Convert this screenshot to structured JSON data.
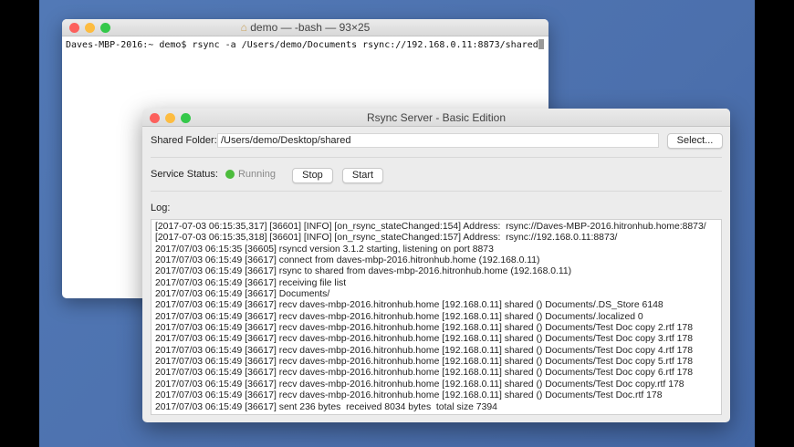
{
  "terminal": {
    "title": "demo — -bash — 93×25",
    "prompt": "Daves-MBP-2016:~ demo$ ",
    "command": "rsync -a /Users/demo/Documents rsync://192.168.0.11:8873/shared"
  },
  "app": {
    "title": "Rsync Server - Basic Edition",
    "shared_folder_label": "Shared Folder:",
    "shared_folder_value": "/Users/demo/Desktop/shared",
    "select_label": "Select...",
    "status_label": "Service Status:",
    "status_value": "Running",
    "status_color": "#4cbc3c",
    "stop_label": "Stop",
    "start_label": "Start",
    "log_label": "Log:",
    "log_lines": [
      "[2017-07-03 06:15:35,317] [36601] [INFO] [on_rsync_stateChanged:154] Address:  rsync://Daves-MBP-2016.hitronhub.home:8873/",
      "[2017-07-03 06:15:35,318] [36601] [INFO] [on_rsync_stateChanged:157] Address:  rsync://192.168.0.11:8873/",
      "2017/07/03 06:15:35 [36605] rsyncd version 3.1.2 starting, listening on port 8873",
      "2017/07/03 06:15:49 [36617] connect from daves-mbp-2016.hitronhub.home (192.168.0.11)",
      "2017/07/03 06:15:49 [36617] rsync to shared from daves-mbp-2016.hitronhub.home (192.168.0.11)",
      "2017/07/03 06:15:49 [36617] receiving file list",
      "2017/07/03 06:15:49 [36617] Documents/",
      "2017/07/03 06:15:49 [36617] recv daves-mbp-2016.hitronhub.home [192.168.0.11] shared () Documents/.DS_Store 6148",
      "2017/07/03 06:15:49 [36617] recv daves-mbp-2016.hitronhub.home [192.168.0.11] shared () Documents/.localized 0",
      "2017/07/03 06:15:49 [36617] recv daves-mbp-2016.hitronhub.home [192.168.0.11] shared () Documents/Test Doc copy 2.rtf 178",
      "2017/07/03 06:15:49 [36617] recv daves-mbp-2016.hitronhub.home [192.168.0.11] shared () Documents/Test Doc copy 3.rtf 178",
      "2017/07/03 06:15:49 [36617] recv daves-mbp-2016.hitronhub.home [192.168.0.11] shared () Documents/Test Doc copy 4.rtf 178",
      "2017/07/03 06:15:49 [36617] recv daves-mbp-2016.hitronhub.home [192.168.0.11] shared () Documents/Test Doc copy 5.rtf 178",
      "2017/07/03 06:15:49 [36617] recv daves-mbp-2016.hitronhub.home [192.168.0.11] shared () Documents/Test Doc copy 6.rtf 178",
      "2017/07/03 06:15:49 [36617] recv daves-mbp-2016.hitronhub.home [192.168.0.11] shared () Documents/Test Doc copy.rtf 178",
      "2017/07/03 06:15:49 [36617] recv daves-mbp-2016.hitronhub.home [192.168.0.11] shared () Documents/Test Doc.rtf 178",
      "2017/07/03 06:15:49 [36617] sent 236 bytes  received 8034 bytes  total size 7394"
    ]
  }
}
